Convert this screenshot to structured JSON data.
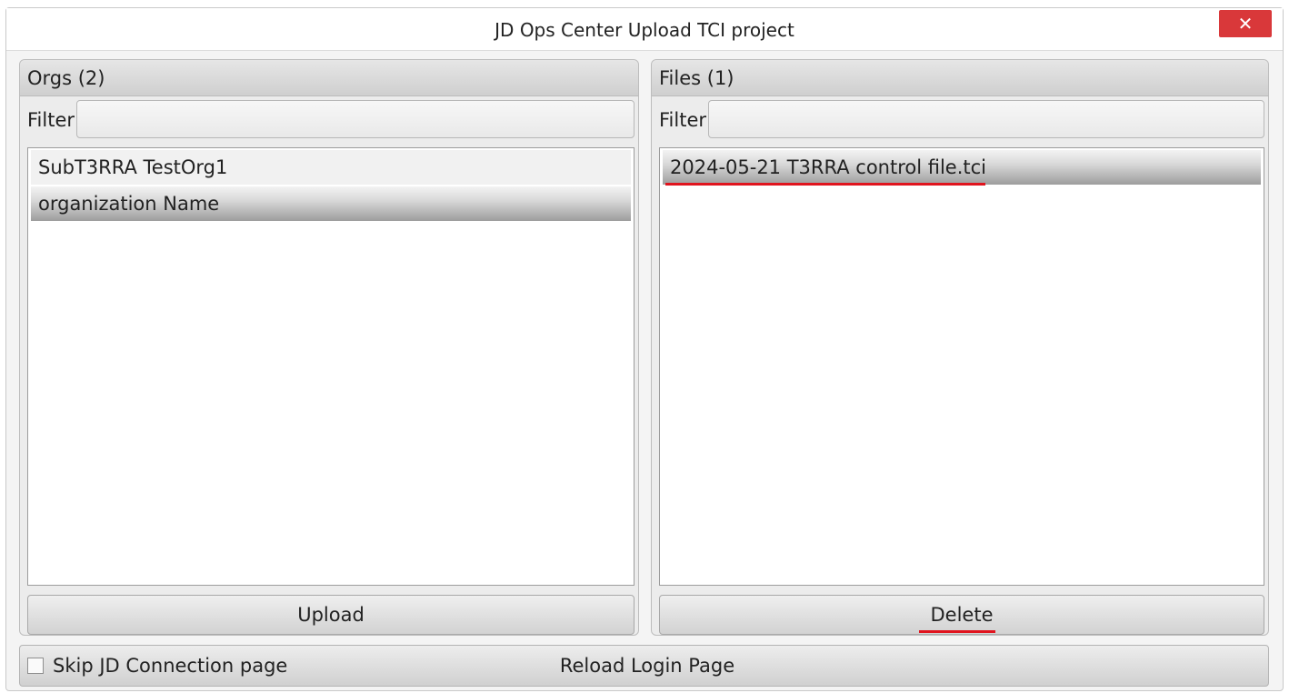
{
  "window": {
    "title": "JD Ops Center Upload TCI project",
    "close_glyph": "✕"
  },
  "orgs_panel": {
    "header": "Orgs (2)",
    "filter_label": "Filter",
    "filter_value": "",
    "items": [
      "SubT3RRA TestOrg1",
      "organization Name"
    ],
    "selected_index": 1,
    "button_label": "Upload"
  },
  "files_panel": {
    "header": "Files (1)",
    "filter_label": "Filter",
    "filter_value": "",
    "items": [
      "2024-05-21 T3RRA control file.tci"
    ],
    "selected_index": 0,
    "button_label": "Delete"
  },
  "bottom_bar": {
    "checkbox_label": "Skip JD Connection page",
    "checkbox_checked": false,
    "reload_label": "Reload Login Page"
  },
  "colors": {
    "close_button": "#d9383a",
    "annotation_underline": "#e0141e"
  }
}
